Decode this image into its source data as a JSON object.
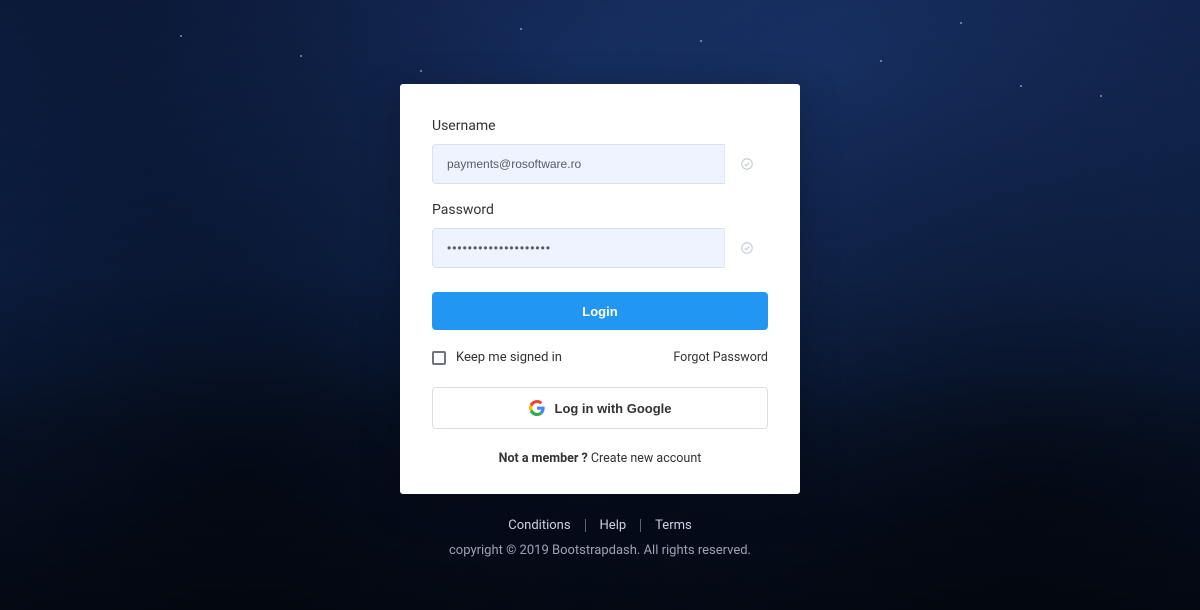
{
  "form": {
    "username_label": "Username",
    "username_value": "payments@rosoftware.ro",
    "password_label": "Password",
    "password_value": "••••••••••••••••••••",
    "login_button": "Login",
    "keep_signed_in_label": "Keep me signed in",
    "forgot_password": "Forgot Password",
    "google_login": "Log in with Google",
    "signup_prompt": "Not a member ?",
    "signup_link": "Create new account"
  },
  "footer": {
    "links": {
      "conditions": "Conditions",
      "help": "Help",
      "terms": "Terms"
    },
    "copyright": "copyright © 2019 Bootstrapdash. All rights reserved."
  },
  "colors": {
    "primary": "#2196f3"
  }
}
